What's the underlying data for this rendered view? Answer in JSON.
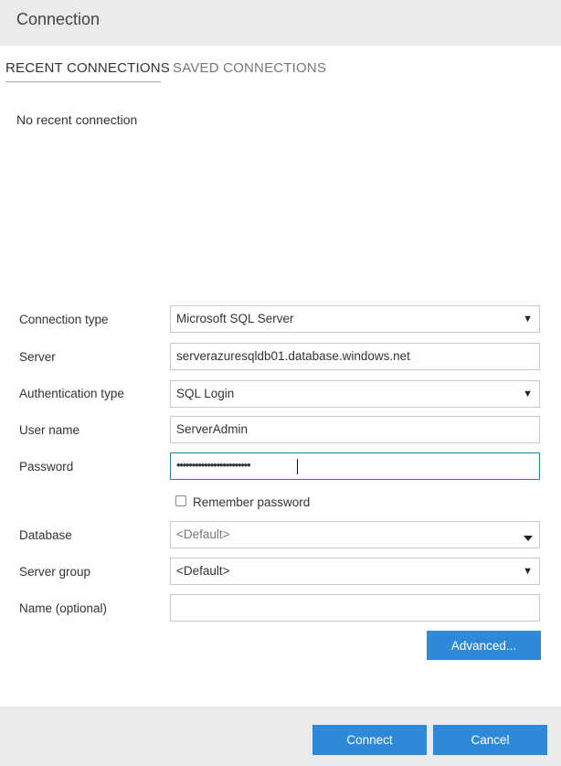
{
  "window": {
    "title": "Connection"
  },
  "tabs": [
    {
      "label": "RECENT CONNECTIONS",
      "active": true
    },
    {
      "label": "SAVED CONNECTIONS",
      "active": false
    }
  ],
  "recent": {
    "empty_message": "No recent connection"
  },
  "form": {
    "connection_type": {
      "label": "Connection type",
      "value": "Microsoft SQL Server"
    },
    "server": {
      "label": "Server",
      "value": "serverazuresqldb01.database.windows.net"
    },
    "auth_type": {
      "label": "Authentication type",
      "value": "SQL Login"
    },
    "user_name": {
      "label": "User name",
      "value": "ServerAdmin"
    },
    "password": {
      "label": "Password",
      "masked_value": "••••••••••••••••••••••••"
    },
    "remember_password": {
      "label": "Remember password",
      "checked": false
    },
    "database": {
      "label": "Database",
      "value": "<Default>"
    },
    "server_group": {
      "label": "Server group",
      "value": "<Default>"
    },
    "name": {
      "label": "Name (optional)",
      "value": ""
    }
  },
  "buttons": {
    "advanced": "Advanced...",
    "connect": "Connect",
    "cancel": "Cancel"
  },
  "colors": {
    "accent": "#2e8ad8",
    "header_bg": "#ebebeb",
    "focus_border": "#2a7fa8"
  },
  "icons": {
    "dropdown": "triangle-down",
    "database_dropdown": "chevron-down"
  }
}
